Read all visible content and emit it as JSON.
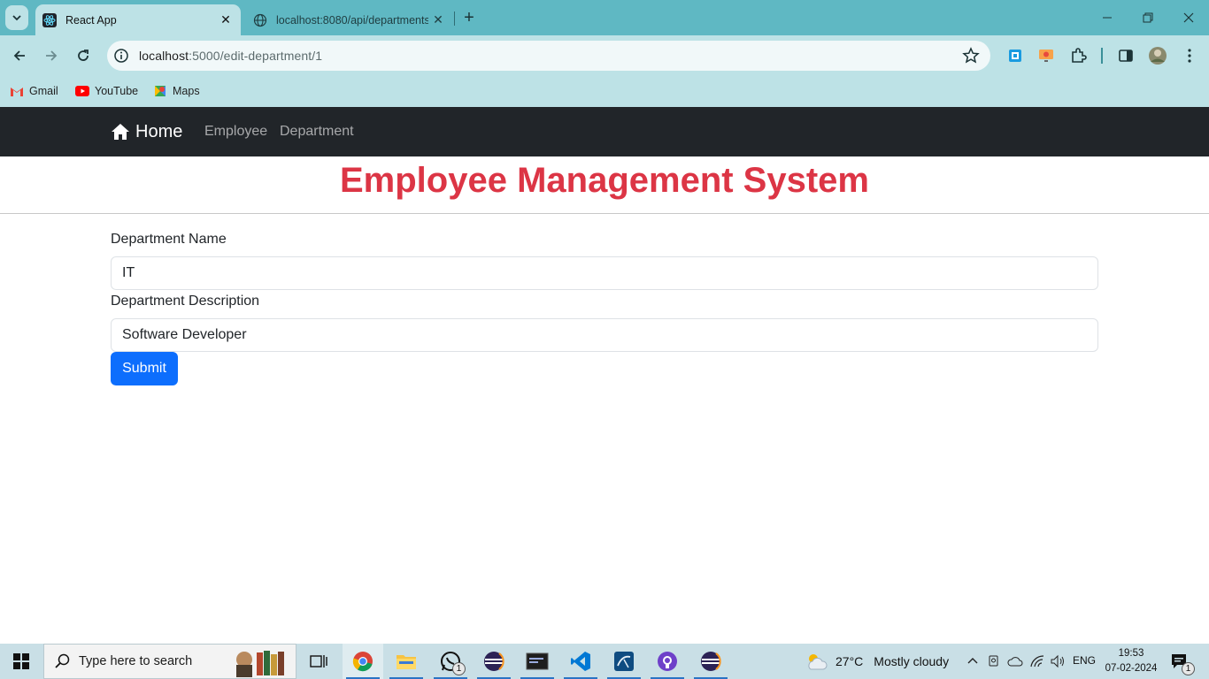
{
  "browser": {
    "tabs": [
      {
        "title": "React App",
        "active": true
      },
      {
        "title": "localhost:8080/api/departments",
        "active": false
      }
    ],
    "url_host": "localhost",
    "url_path": ":5000/edit-department/1",
    "bookmarks": [
      {
        "label": "Gmail",
        "icon": "gmail-icon"
      },
      {
        "label": "YouTube",
        "icon": "youtube-icon"
      },
      {
        "label": "Maps",
        "icon": "maps-icon"
      }
    ]
  },
  "navbar": {
    "brand": "Home",
    "links": [
      "Employee",
      "Department"
    ]
  },
  "page": {
    "title": "Employee Management System"
  },
  "form": {
    "name_label": "Department Name",
    "name_value": "IT",
    "description_label": "Department Description",
    "description_value": "Software Developer",
    "submit_label": "Submit"
  },
  "taskbar": {
    "search_placeholder": "Type here to search",
    "whatsapp_badge": "1",
    "weather_temp": "27°C",
    "weather_desc": "Mostly cloudy",
    "language": "ENG",
    "time": "19:53",
    "date": "07-02-2024",
    "notifications": "1"
  },
  "colors": {
    "tabstrip": "#5fb8c3",
    "toolbar": "#bde2e6",
    "navbar": "#212529",
    "title": "#dc3545",
    "button": "#0d6efd"
  }
}
